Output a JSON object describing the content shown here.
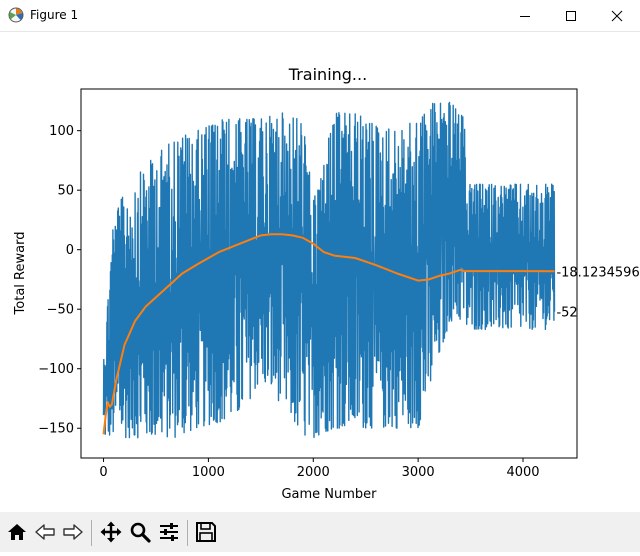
{
  "window": {
    "title": "Figure 1",
    "icon": "matplotlib-figure-icon",
    "controls": [
      "minimize-icon",
      "maximize-icon",
      "close-icon"
    ]
  },
  "toolbar": {
    "buttons": [
      {
        "name": "home-button",
        "icon": "home-icon"
      },
      {
        "name": "back-button",
        "icon": "arrow-left-icon"
      },
      {
        "name": "forward-button",
        "icon": "arrow-right-icon"
      },
      {
        "name": "pan-button",
        "icon": "move-icon"
      },
      {
        "name": "zoom-button",
        "icon": "magnifier-icon"
      },
      {
        "name": "configure-subplots-button",
        "icon": "sliders-icon"
      },
      {
        "name": "save-button",
        "icon": "floppy-disk-icon"
      }
    ]
  },
  "colors": {
    "raw_series": "#1f77b4",
    "mean_series": "#ff7f0e",
    "toolbar_bg": "#f0f0f0"
  },
  "chart_data": {
    "type": "line",
    "title": "Training...",
    "xlabel": "Game Number",
    "ylabel": "Total Reward",
    "xlim": [
      -215,
      4515
    ],
    "ylim": [
      -175,
      135
    ],
    "xticks": [
      0,
      1000,
      2000,
      3000,
      4000
    ],
    "yticks": [
      -150,
      -100,
      -50,
      0,
      50,
      100
    ],
    "grid": false,
    "legend": "none",
    "series": [
      {
        "role": "raw",
        "x_end": 4300,
        "envelope": [
          {
            "x": 0,
            "lo": -158,
            "hi": -90
          },
          {
            "x": 40,
            "lo": -158,
            "hi": -40
          },
          {
            "x": 80,
            "lo": -158,
            "hi": 20
          },
          {
            "x": 150,
            "lo": -158,
            "hi": 40
          },
          {
            "x": 300,
            "lo": -158,
            "hi": 60
          },
          {
            "x": 500,
            "lo": -158,
            "hi": 80
          },
          {
            "x": 700,
            "lo": -158,
            "hi": 95
          },
          {
            "x": 900,
            "lo": -150,
            "hi": 100
          },
          {
            "x": 1100,
            "lo": -145,
            "hi": 110
          },
          {
            "x": 1300,
            "lo": -140,
            "hi": 110
          },
          {
            "x": 1500,
            "lo": -110,
            "hi": 110
          },
          {
            "x": 1700,
            "lo": -130,
            "hi": 115
          },
          {
            "x": 1900,
            "lo": -158,
            "hi": 110
          },
          {
            "x": 2000,
            "lo": -158,
            "hi": 40
          },
          {
            "x": 2200,
            "lo": -150,
            "hi": 115
          },
          {
            "x": 2400,
            "lo": -150,
            "hi": 115
          },
          {
            "x": 2600,
            "lo": -150,
            "hi": 105
          },
          {
            "x": 2800,
            "lo": -150,
            "hi": 100
          },
          {
            "x": 3000,
            "lo": -150,
            "hi": 110
          },
          {
            "x": 3150,
            "lo": -110,
            "hi": 125
          },
          {
            "x": 3300,
            "lo": -60,
            "hi": 125
          },
          {
            "x": 3440,
            "lo": -60,
            "hi": 110
          },
          {
            "x": 3460,
            "lo": -67,
            "hi": 55
          },
          {
            "x": 4300,
            "lo": -67,
            "hi": 55
          }
        ],
        "last_value_label": "-52"
      },
      {
        "role": "mean",
        "x": [
          0,
          20,
          40,
          60,
          80,
          120,
          200,
          300,
          400,
          500,
          600,
          750,
          900,
          1100,
          1300,
          1500,
          1600,
          1700,
          1800,
          1900,
          2000,
          2100,
          2200,
          2400,
          2600,
          2800,
          3000,
          3100,
          3200,
          3300,
          3400,
          3440,
          3500,
          3700,
          4000,
          4300
        ],
        "y": [
          -155,
          -140,
          -128,
          -132,
          -130,
          -110,
          -80,
          -60,
          -48,
          -40,
          -32,
          -20,
          -12,
          -2,
          5,
          12,
          13,
          13,
          12,
          10,
          5,
          -2,
          -5,
          -7,
          -13,
          -20,
          -26,
          -25,
          -22,
          -20,
          -17,
          -18,
          -18,
          -18,
          -18,
          -18.1234596
        ],
        "last_value_label": "-18.1234596"
      }
    ]
  }
}
